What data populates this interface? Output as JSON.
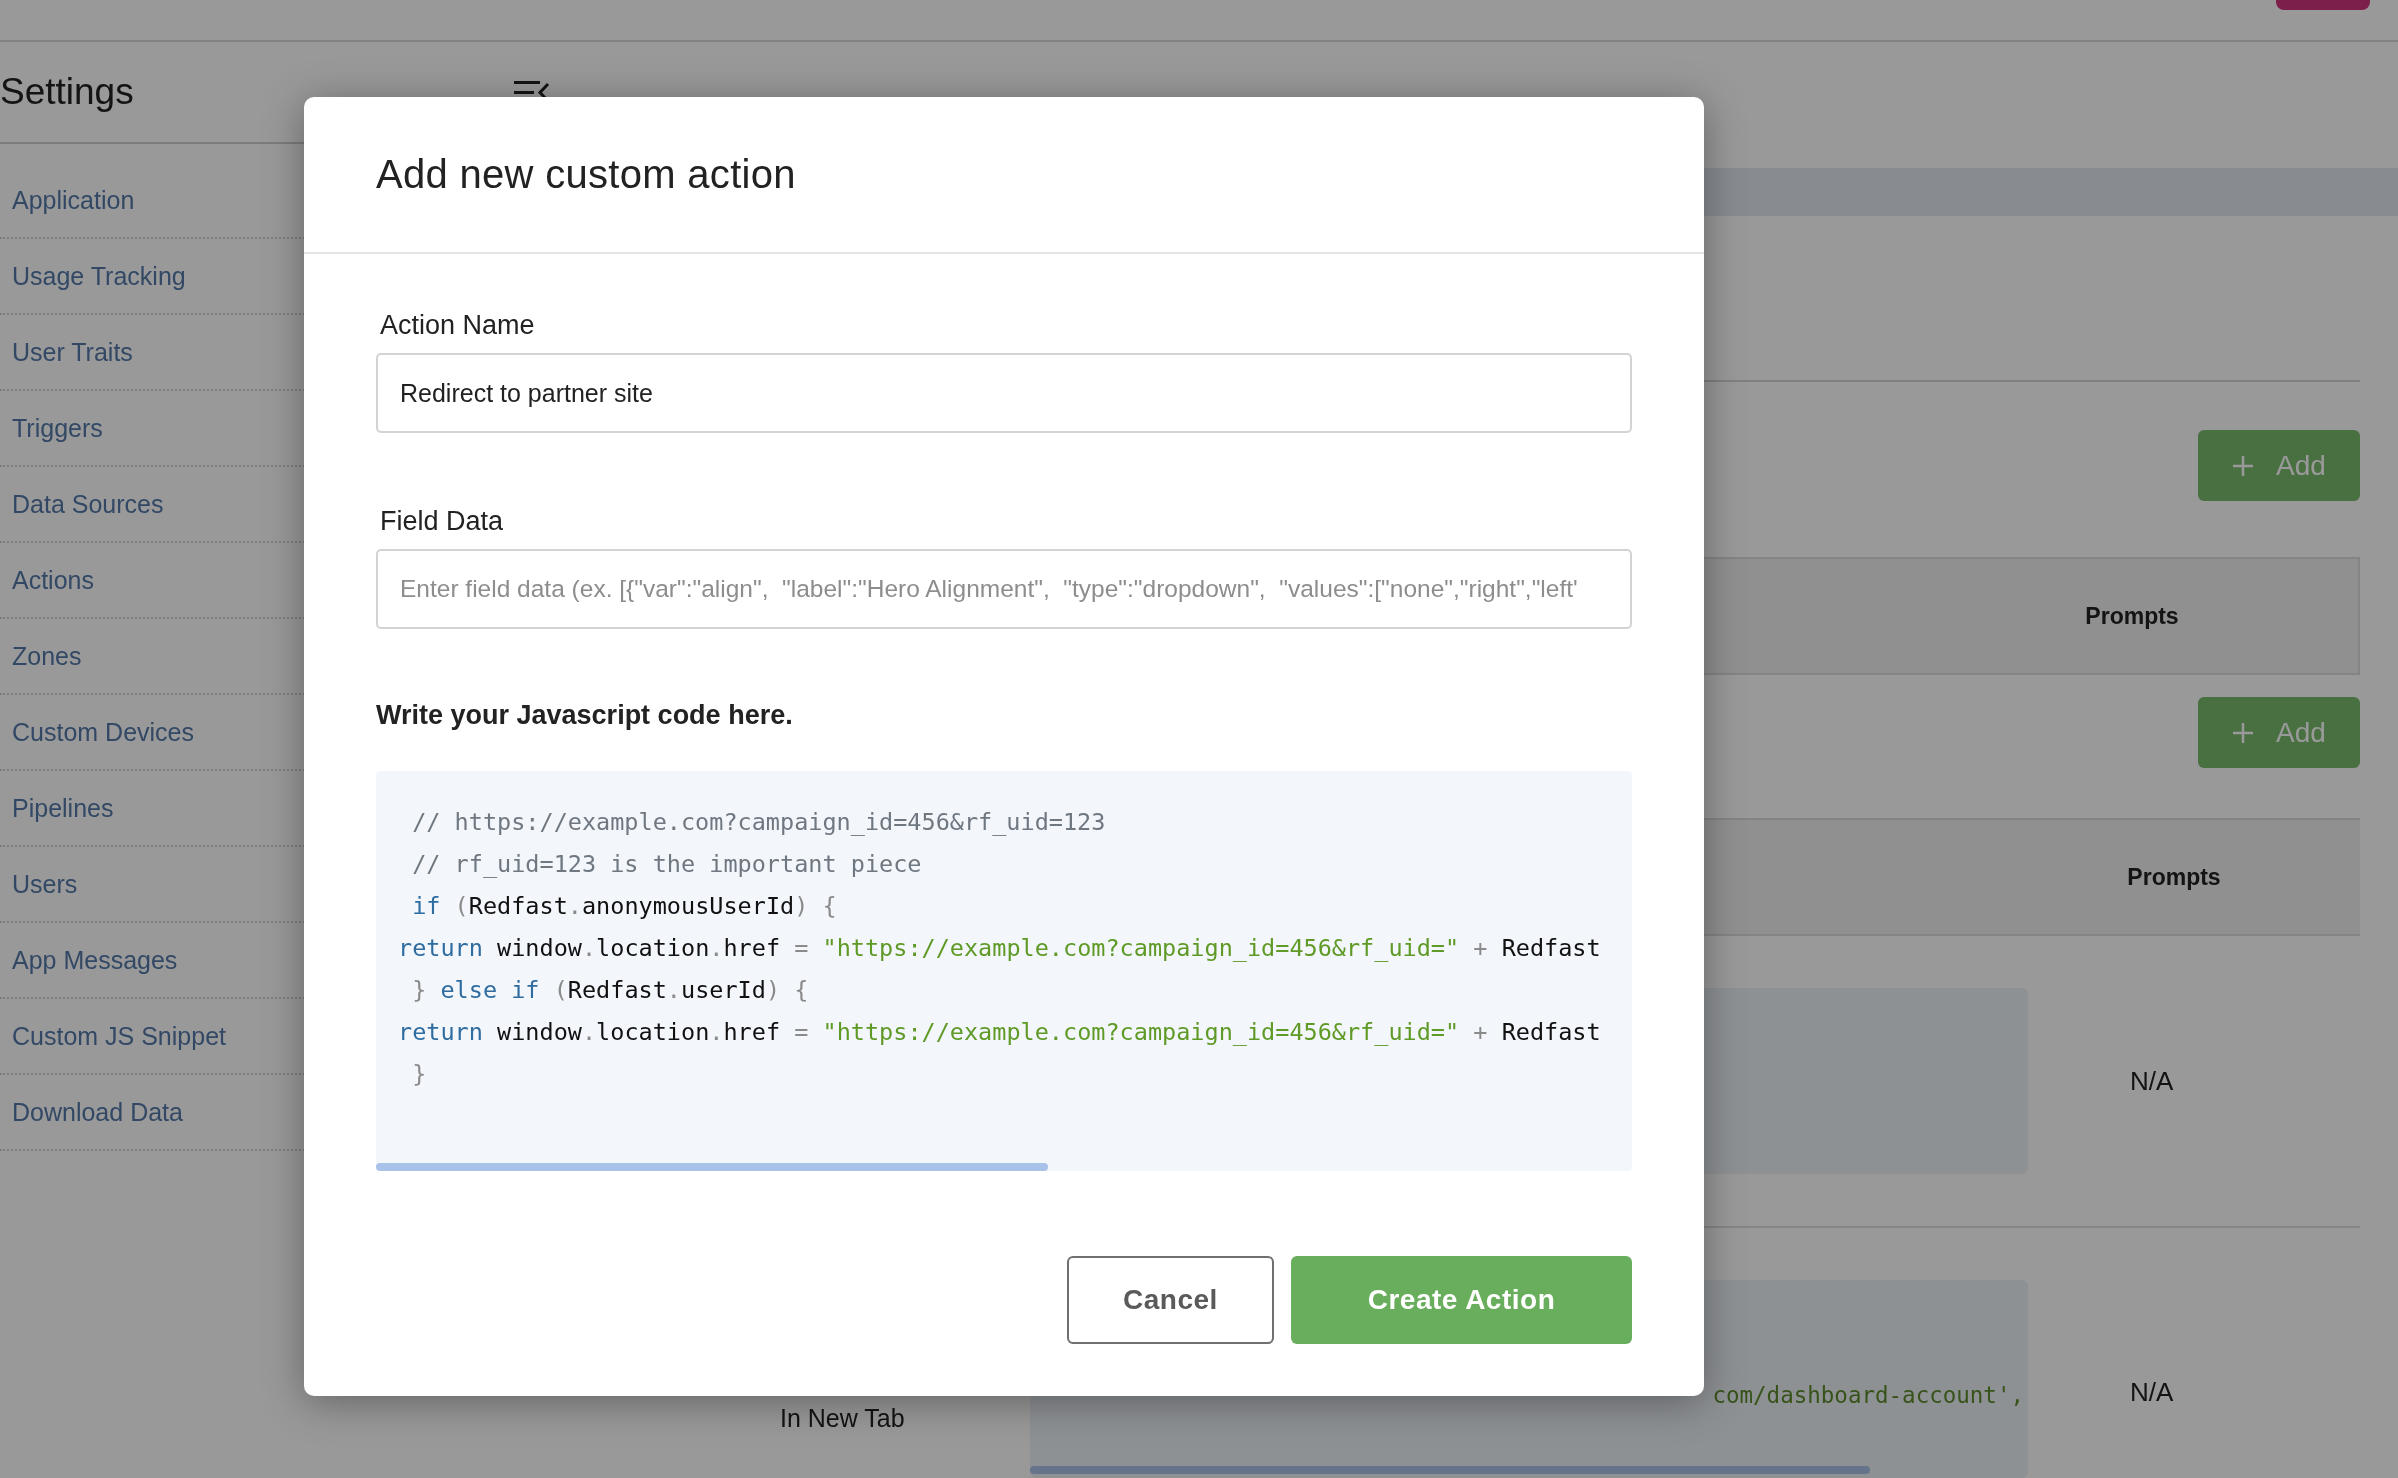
{
  "sidebar": {
    "title": "Settings",
    "items": [
      {
        "label": "Application"
      },
      {
        "label": "Usage Tracking"
      },
      {
        "label": "User Traits"
      },
      {
        "label": "Triggers"
      },
      {
        "label": "Data Sources"
      },
      {
        "label": "Actions"
      },
      {
        "label": "Zones"
      },
      {
        "label": "Custom Devices"
      },
      {
        "label": "Pipelines"
      },
      {
        "label": "Users"
      },
      {
        "label": "App Messages"
      },
      {
        "label": "Custom JS Snippet"
      },
      {
        "label": "Download Data"
      }
    ]
  },
  "main": {
    "sections": [
      {
        "add_button": "Add",
        "column": "Prompts"
      },
      {
        "add_button": "Add",
        "column": "Prompts",
        "rows": [
          {
            "prompts": "N/A"
          },
          {
            "label": "In New Tab",
            "code_fragment": "com/dashboard-account',",
            "prompts": "N/A"
          }
        ]
      }
    ]
  },
  "modal": {
    "title": "Add new custom action",
    "fields": [
      {
        "label": "Action Name",
        "value": "Redirect to partner site"
      },
      {
        "label": "Field Data",
        "placeholder": "Enter field data (ex. [{\"var\":\"align\",  \"label\":\"Hero Alignment\",  \"type\":\"dropdown\",  \"values\":[\"none\",\"right\",\"left'"
      }
    ],
    "code_label": "Write your Javascript code here.",
    "code_lines": [
      [
        {
          "kind": "comment",
          "text": " // https://example.com?campaign_id=456&rf_uid=123"
        }
      ],
      [
        {
          "kind": "comment",
          "text": " // rf_uid=123 is the important piece"
        }
      ],
      [
        {
          "kind": "keyword",
          "text": " if"
        },
        {
          "kind": "punct",
          "text": " ("
        },
        {
          "kind": "plain",
          "text": "Redfast"
        },
        {
          "kind": "punct",
          "text": "."
        },
        {
          "kind": "plain",
          "text": "anonymousUserId"
        },
        {
          "kind": "punct",
          "text": ") {"
        }
      ],
      [
        {
          "kind": "keyword",
          "text": "return"
        },
        {
          "kind": "plain",
          "text": " window"
        },
        {
          "kind": "punct",
          "text": "."
        },
        {
          "kind": "plain",
          "text": "location"
        },
        {
          "kind": "punct",
          "text": "."
        },
        {
          "kind": "plain",
          "text": "href "
        },
        {
          "kind": "punct",
          "text": "="
        },
        {
          "kind": "string",
          "text": " \"https://example.com?campaign_id=456&rf_uid=\""
        },
        {
          "kind": "punct",
          "text": " + "
        },
        {
          "kind": "plain",
          "text": "Redfast"
        }
      ],
      [
        {
          "kind": "punct",
          "text": " } "
        },
        {
          "kind": "keyword",
          "text": "else if"
        },
        {
          "kind": "punct",
          "text": " ("
        },
        {
          "kind": "plain",
          "text": "Redfast"
        },
        {
          "kind": "punct",
          "text": "."
        },
        {
          "kind": "plain",
          "text": "userId"
        },
        {
          "kind": "punct",
          "text": ") {"
        }
      ],
      [
        {
          "kind": "keyword",
          "text": "return"
        },
        {
          "kind": "plain",
          "text": " window"
        },
        {
          "kind": "punct",
          "text": "."
        },
        {
          "kind": "plain",
          "text": "location"
        },
        {
          "kind": "punct",
          "text": "."
        },
        {
          "kind": "plain",
          "text": "href "
        },
        {
          "kind": "punct",
          "text": "="
        },
        {
          "kind": "string",
          "text": " \"https://example.com?campaign_id=456&rf_uid=\""
        },
        {
          "kind": "punct",
          "text": " + "
        },
        {
          "kind": "plain",
          "text": "Redfast"
        }
      ],
      [
        {
          "kind": "punct",
          "text": " }"
        }
      ]
    ],
    "buttons": [
      {
        "label": "Cancel",
        "kind": "secondary"
      },
      {
        "label": "Create Action",
        "kind": "primary"
      }
    ]
  }
}
